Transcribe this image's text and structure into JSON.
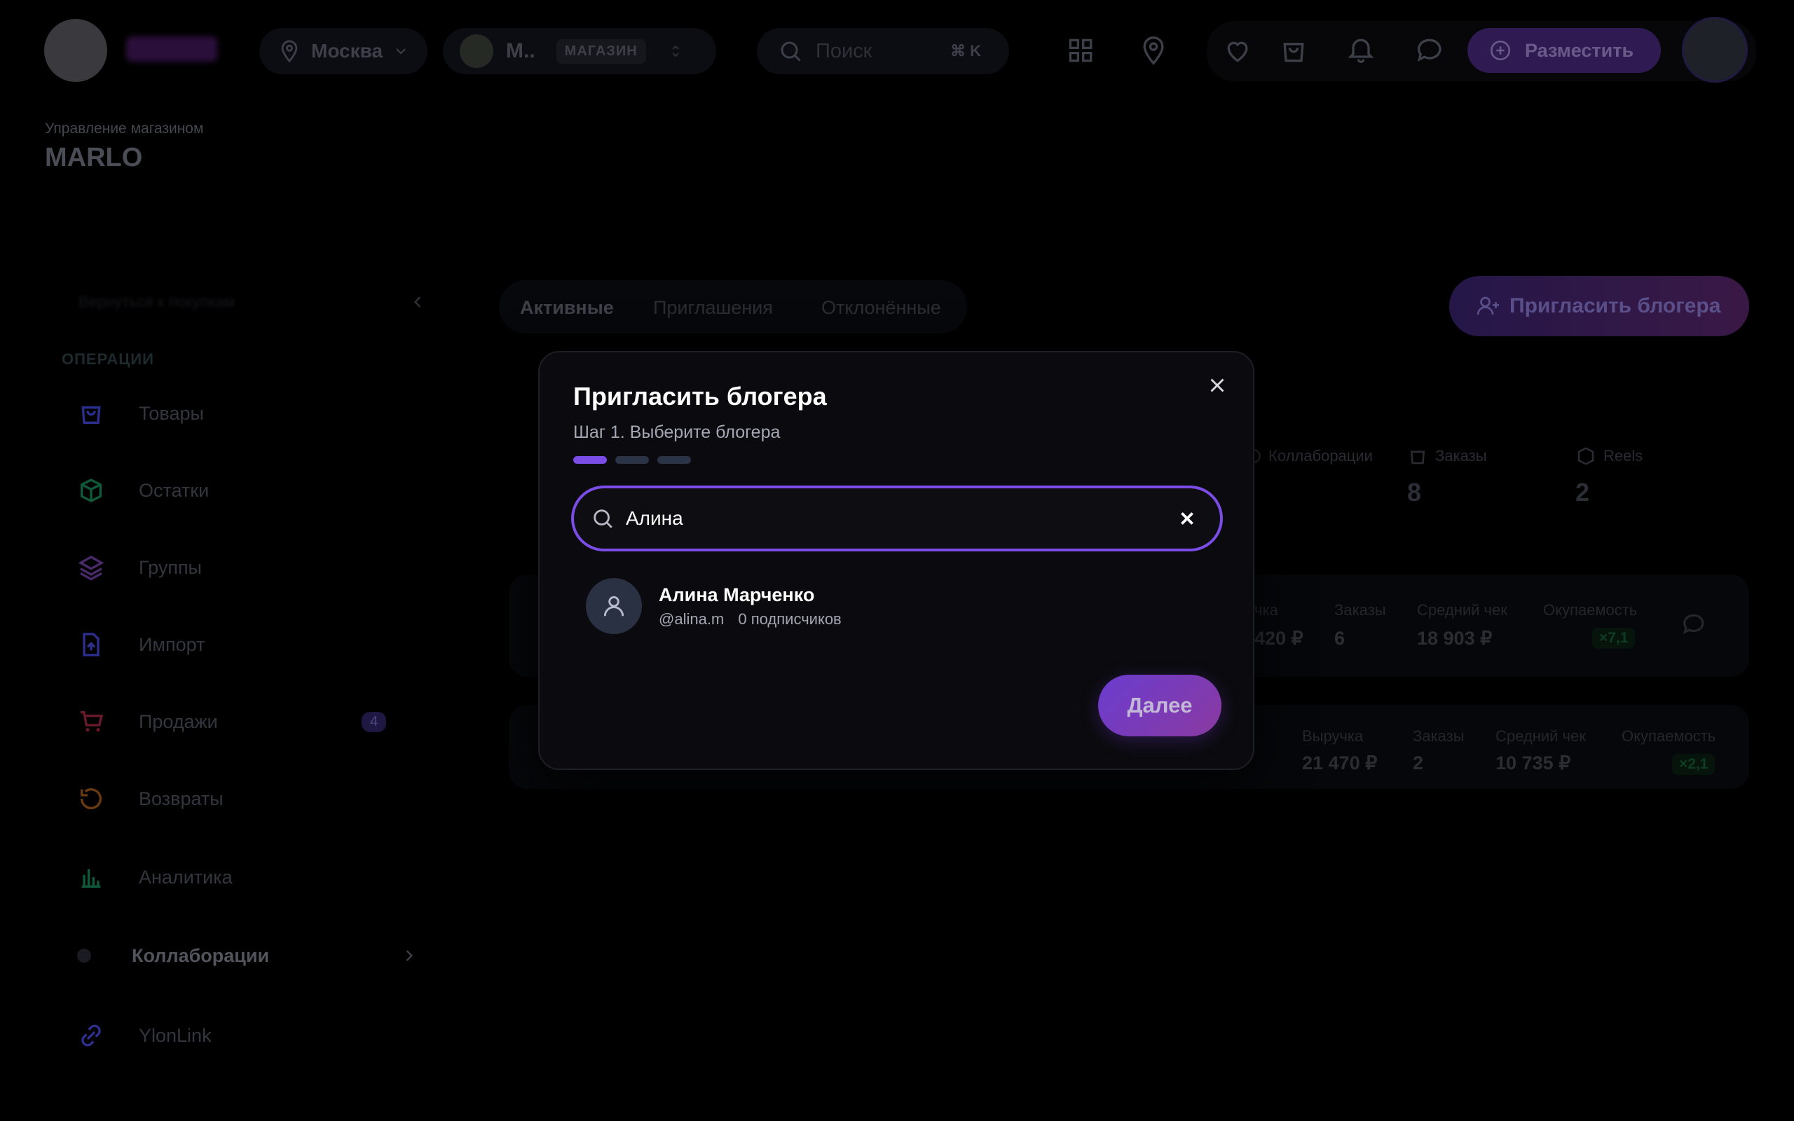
{
  "topbar": {
    "city": "Москва",
    "store_name": "М..",
    "store_badge": "МАГАЗИН",
    "search_placeholder": "Поиск",
    "search_shortcut": "⌘ K",
    "post_button": "Разместить"
  },
  "header": {
    "subtitle": "Управление магазином",
    "title": "MARLO"
  },
  "sidebar": {
    "back_label": "Вернуться к покупкам",
    "section_label": "ОПЕРАЦИИ",
    "items": [
      {
        "label": "Товары",
        "icon": "bag-icon",
        "color": "#2b2f8f"
      },
      {
        "label": "Остатки",
        "icon": "box-icon",
        "color": "#0f5a3a"
      },
      {
        "label": "Группы",
        "icon": "layers-icon",
        "color": "#4a2a6a"
      },
      {
        "label": "Импорт",
        "icon": "file-upload-icon",
        "color": "#2f2f8f"
      },
      {
        "label": "Продажи",
        "icon": "cart-icon",
        "color": "#6a1a2a",
        "badge": "4"
      },
      {
        "label": "Возвраты",
        "icon": "refresh-icon",
        "color": "#6a3a10"
      },
      {
        "label": "Аналитика",
        "icon": "bar-chart-icon",
        "color": "#0f5a3a"
      },
      {
        "label": "Коллаборации",
        "icon": "handshake-icon",
        "color": "#1a1a22"
      },
      {
        "label": "YlonLink",
        "icon": "link-icon",
        "color": "#2f2f8f"
      }
    ]
  },
  "main": {
    "tabs": [
      "Активные",
      "Приглашения",
      "Отклонённые"
    ],
    "invite_button": "Пригласить блогера",
    "stats": {
      "collab_label": "Коллаборации",
      "orders_label": "Заказы",
      "orders_value": "8",
      "reels_label": "Reels",
      "reels_value": "2"
    },
    "row1": {
      "revenue_label": "чка",
      "revenue_value": "420 ₽",
      "orders_label": "Заказы",
      "orders_value": "6",
      "avg_label": "Средний чек",
      "avg_value": "18 903 ₽",
      "payback_label": "Окупаемость",
      "payback_value": "×7,1"
    },
    "row2": {
      "revenue_label": "Выручка",
      "revenue_value": "21 470 ₽",
      "orders_label": "Заказы",
      "orders_value": "2",
      "avg_label": "Средний чек",
      "avg_value": "10 735 ₽",
      "payback_label": "Окупаемость",
      "payback_value": "×2,1"
    }
  },
  "modal": {
    "title": "Пригласить блогера",
    "step": "Шаг 1. Выберите блогера",
    "search_value": "Алина",
    "result": {
      "name": "Алина Марченко",
      "handle": "@alina.m",
      "followers": "0 подписчиков"
    },
    "next_button": "Далее",
    "accent": "#7b4ce6"
  }
}
